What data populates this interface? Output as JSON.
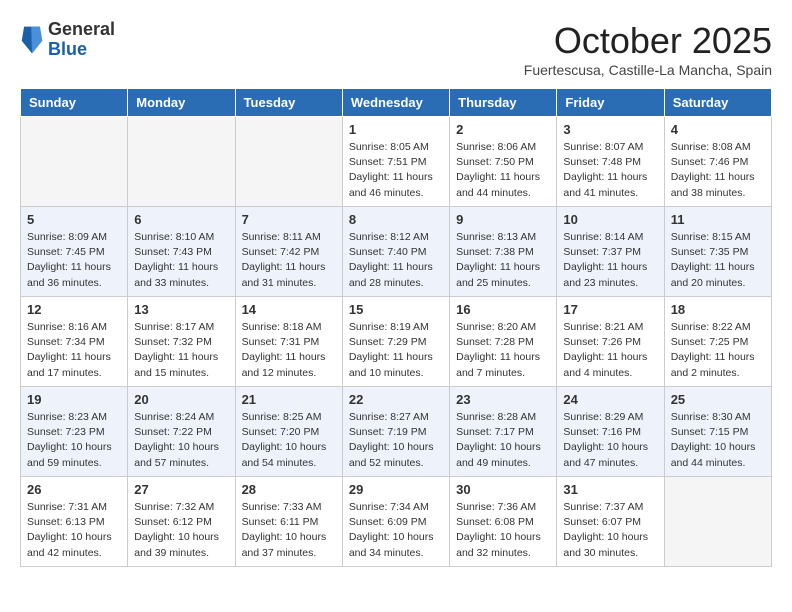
{
  "header": {
    "logo_general": "General",
    "logo_blue": "Blue",
    "title": "October 2025",
    "location": "Fuertescusa, Castille-La Mancha, Spain"
  },
  "days_of_week": [
    "Sunday",
    "Monday",
    "Tuesday",
    "Wednesday",
    "Thursday",
    "Friday",
    "Saturday"
  ],
  "weeks": [
    [
      {
        "day": "",
        "info": ""
      },
      {
        "day": "",
        "info": ""
      },
      {
        "day": "",
        "info": ""
      },
      {
        "day": "1",
        "info": "Sunrise: 8:05 AM\nSunset: 7:51 PM\nDaylight: 11 hours\nand 46 minutes."
      },
      {
        "day": "2",
        "info": "Sunrise: 8:06 AM\nSunset: 7:50 PM\nDaylight: 11 hours\nand 44 minutes."
      },
      {
        "day": "3",
        "info": "Sunrise: 8:07 AM\nSunset: 7:48 PM\nDaylight: 11 hours\nand 41 minutes."
      },
      {
        "day": "4",
        "info": "Sunrise: 8:08 AM\nSunset: 7:46 PM\nDaylight: 11 hours\nand 38 minutes."
      }
    ],
    [
      {
        "day": "5",
        "info": "Sunrise: 8:09 AM\nSunset: 7:45 PM\nDaylight: 11 hours\nand 36 minutes."
      },
      {
        "day": "6",
        "info": "Sunrise: 8:10 AM\nSunset: 7:43 PM\nDaylight: 11 hours\nand 33 minutes."
      },
      {
        "day": "7",
        "info": "Sunrise: 8:11 AM\nSunset: 7:42 PM\nDaylight: 11 hours\nand 31 minutes."
      },
      {
        "day": "8",
        "info": "Sunrise: 8:12 AM\nSunset: 7:40 PM\nDaylight: 11 hours\nand 28 minutes."
      },
      {
        "day": "9",
        "info": "Sunrise: 8:13 AM\nSunset: 7:38 PM\nDaylight: 11 hours\nand 25 minutes."
      },
      {
        "day": "10",
        "info": "Sunrise: 8:14 AM\nSunset: 7:37 PM\nDaylight: 11 hours\nand 23 minutes."
      },
      {
        "day": "11",
        "info": "Sunrise: 8:15 AM\nSunset: 7:35 PM\nDaylight: 11 hours\nand 20 minutes."
      }
    ],
    [
      {
        "day": "12",
        "info": "Sunrise: 8:16 AM\nSunset: 7:34 PM\nDaylight: 11 hours\nand 17 minutes."
      },
      {
        "day": "13",
        "info": "Sunrise: 8:17 AM\nSunset: 7:32 PM\nDaylight: 11 hours\nand 15 minutes."
      },
      {
        "day": "14",
        "info": "Sunrise: 8:18 AM\nSunset: 7:31 PM\nDaylight: 11 hours\nand 12 minutes."
      },
      {
        "day": "15",
        "info": "Sunrise: 8:19 AM\nSunset: 7:29 PM\nDaylight: 11 hours\nand 10 minutes."
      },
      {
        "day": "16",
        "info": "Sunrise: 8:20 AM\nSunset: 7:28 PM\nDaylight: 11 hours\nand 7 minutes."
      },
      {
        "day": "17",
        "info": "Sunrise: 8:21 AM\nSunset: 7:26 PM\nDaylight: 11 hours\nand 4 minutes."
      },
      {
        "day": "18",
        "info": "Sunrise: 8:22 AM\nSunset: 7:25 PM\nDaylight: 11 hours\nand 2 minutes."
      }
    ],
    [
      {
        "day": "19",
        "info": "Sunrise: 8:23 AM\nSunset: 7:23 PM\nDaylight: 10 hours\nand 59 minutes."
      },
      {
        "day": "20",
        "info": "Sunrise: 8:24 AM\nSunset: 7:22 PM\nDaylight: 10 hours\nand 57 minutes."
      },
      {
        "day": "21",
        "info": "Sunrise: 8:25 AM\nSunset: 7:20 PM\nDaylight: 10 hours\nand 54 minutes."
      },
      {
        "day": "22",
        "info": "Sunrise: 8:27 AM\nSunset: 7:19 PM\nDaylight: 10 hours\nand 52 minutes."
      },
      {
        "day": "23",
        "info": "Sunrise: 8:28 AM\nSunset: 7:17 PM\nDaylight: 10 hours\nand 49 minutes."
      },
      {
        "day": "24",
        "info": "Sunrise: 8:29 AM\nSunset: 7:16 PM\nDaylight: 10 hours\nand 47 minutes."
      },
      {
        "day": "25",
        "info": "Sunrise: 8:30 AM\nSunset: 7:15 PM\nDaylight: 10 hours\nand 44 minutes."
      }
    ],
    [
      {
        "day": "26",
        "info": "Sunrise: 7:31 AM\nSunset: 6:13 PM\nDaylight: 10 hours\nand 42 minutes."
      },
      {
        "day": "27",
        "info": "Sunrise: 7:32 AM\nSunset: 6:12 PM\nDaylight: 10 hours\nand 39 minutes."
      },
      {
        "day": "28",
        "info": "Sunrise: 7:33 AM\nSunset: 6:11 PM\nDaylight: 10 hours\nand 37 minutes."
      },
      {
        "day": "29",
        "info": "Sunrise: 7:34 AM\nSunset: 6:09 PM\nDaylight: 10 hours\nand 34 minutes."
      },
      {
        "day": "30",
        "info": "Sunrise: 7:36 AM\nSunset: 6:08 PM\nDaylight: 10 hours\nand 32 minutes."
      },
      {
        "day": "31",
        "info": "Sunrise: 7:37 AM\nSunset: 6:07 PM\nDaylight: 10 hours\nand 30 minutes."
      },
      {
        "day": "",
        "info": ""
      }
    ]
  ]
}
